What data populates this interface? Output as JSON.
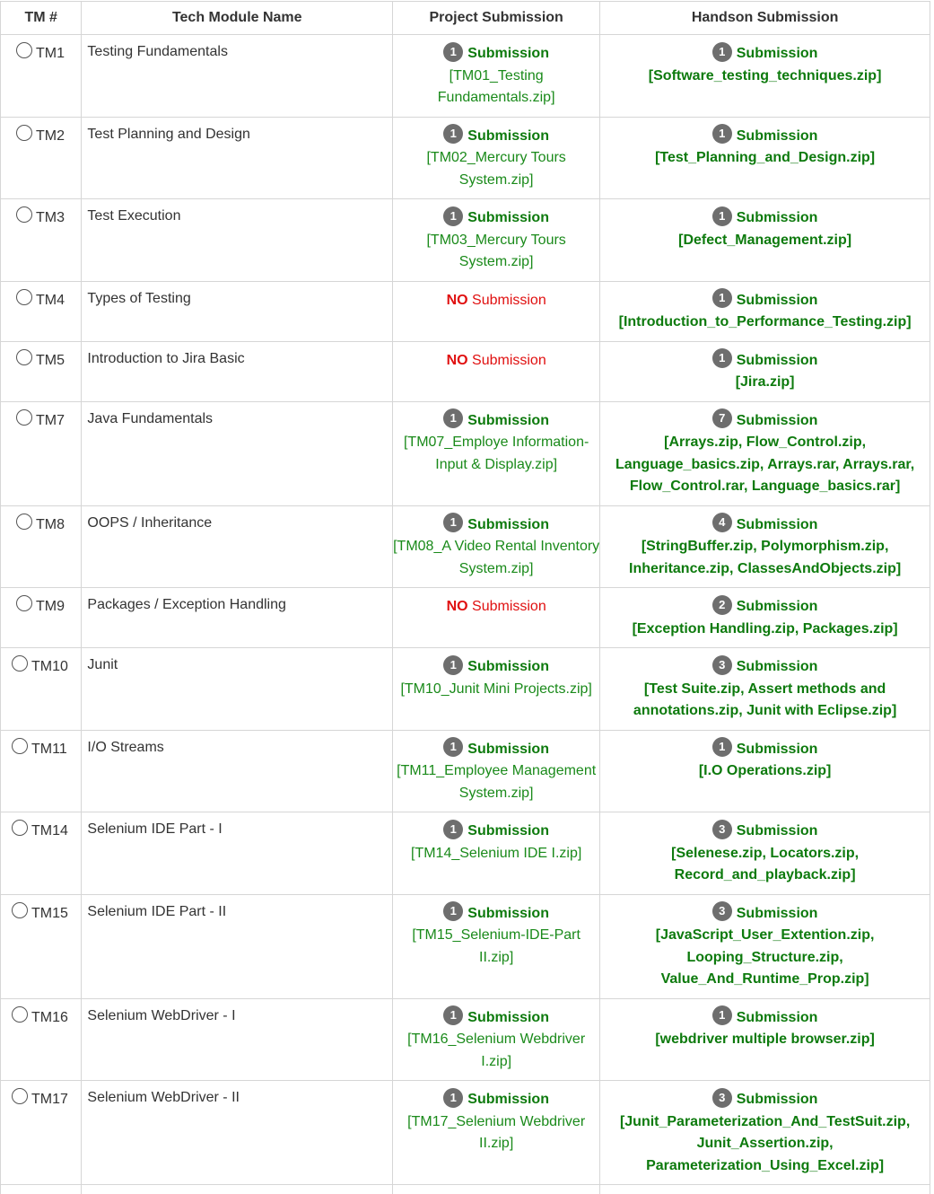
{
  "headers": {
    "tm": "TM #",
    "name": "Tech Module Name",
    "project": "Project Submission",
    "handson": "Handson Submission"
  },
  "labels": {
    "submission": "Submission",
    "no": "NO"
  },
  "colors": {
    "green": "#1a8a1a",
    "dark_green": "#0d7a0d",
    "red": "#e01010",
    "badge": "#6e6e6e"
  },
  "rows": [
    {
      "tm": "TM1",
      "name": "Testing Fundamentals",
      "project": {
        "count": "1",
        "files": "[TM01_Testing Fundamentals.zip]"
      },
      "handson": {
        "count": "1",
        "files": "[Software_testing_techniques.zip]"
      }
    },
    {
      "tm": "TM2",
      "name": "Test Planning and Design",
      "project": {
        "count": "1",
        "files": "[TM02_Mercury Tours System.zip]"
      },
      "handson": {
        "count": "1",
        "files": "[Test_Planning_and_Design.zip]"
      }
    },
    {
      "tm": "TM3",
      "name": "Test Execution",
      "project": {
        "count": "1",
        "files": "[TM03_Mercury Tours System.zip]"
      },
      "handson": {
        "count": "1",
        "files": "[Defect_Management.zip]"
      }
    },
    {
      "tm": "TM4",
      "name": "Types of Testing",
      "project": null,
      "handson": {
        "count": "1",
        "files": "[Introduction_to_Performance_Testing.zip]"
      }
    },
    {
      "tm": "TM5",
      "name": "Introduction to Jira Basic",
      "project": null,
      "handson": {
        "count": "1",
        "files": "[Jira.zip]"
      }
    },
    {
      "tm": "TM7",
      "name": "Java Fundamentals",
      "project": {
        "count": "1",
        "files": "[TM07_Employe Information-Input & Display.zip]"
      },
      "handson": {
        "count": "7",
        "files": "[Arrays.zip, Flow_Control.zip, Language_basics.zip, Arrays.rar, Arrays.rar, Flow_Control.rar, Language_basics.rar]"
      }
    },
    {
      "tm": "TM8",
      "name": "OOPS / Inheritance",
      "project": {
        "count": "1",
        "files": "[TM08_A Video Rental Inventory System.zip]"
      },
      "handson": {
        "count": "4",
        "files": "[StringBuffer.zip, Polymorphism.zip, Inheritance.zip, ClassesAndObjects.zip]"
      }
    },
    {
      "tm": "TM9",
      "name": "Packages / Exception Handling",
      "project": null,
      "handson": {
        "count": "2",
        "files": "[Exception Handling.zip, Packages.zip]"
      }
    },
    {
      "tm": "TM10",
      "name": "Junit",
      "project": {
        "count": "1",
        "files": "[TM10_Junit Mini Projects.zip]"
      },
      "handson": {
        "count": "3",
        "files": "[Test Suite.zip, Assert methods and annotations.zip, Junit with Eclipse.zip]"
      }
    },
    {
      "tm": "TM11",
      "name": "I/O Streams",
      "project": {
        "count": "1",
        "files": "[TM11_Employee Management System.zip]"
      },
      "handson": {
        "count": "1",
        "files": "[I.O Operations.zip]"
      }
    },
    {
      "tm": "TM14",
      "name": "Selenium IDE Part - I",
      "project": {
        "count": "1",
        "files": "[TM14_Selenium IDE I.zip]"
      },
      "handson": {
        "count": "3",
        "files": "[Selenese.zip, Locators.zip, Record_and_playback.zip]"
      }
    },
    {
      "tm": "TM15",
      "name": "Selenium IDE Part - II",
      "project": {
        "count": "1",
        "files": "[TM15_Selenium-IDE-Part II.zip]"
      },
      "handson": {
        "count": "3",
        "files": "[JavaScript_User_Extention.zip, Looping_Structure.zip, Value_And_Runtime_Prop.zip]"
      }
    },
    {
      "tm": "TM16",
      "name": "Selenium WebDriver - I",
      "project": {
        "count": "1",
        "files": "[TM16_Selenium Webdriver I.zip]"
      },
      "handson": {
        "count": "1",
        "files": "[webdriver multiple browser.zip]"
      }
    },
    {
      "tm": "TM17",
      "name": "Selenium WebDriver - II",
      "project": {
        "count": "1",
        "files": "[TM17_Selenium Webdriver II.zip]"
      },
      "handson": {
        "count": "3",
        "files": "[Junit_Parameterization_And_TestSuit.zip, Junit_Assertion.zip, Parameterization_Using_Excel.zip]"
      }
    }
  ]
}
